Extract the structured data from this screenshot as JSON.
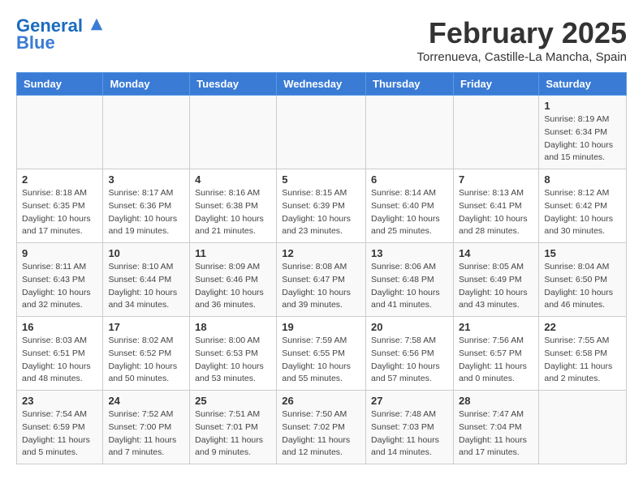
{
  "app": {
    "name": "GeneralBlue",
    "name_part1": "General",
    "name_part2": "Blue"
  },
  "calendar": {
    "month_year": "February 2025",
    "location": "Torrenueva, Castille-La Mancha, Spain",
    "days_of_week": [
      "Sunday",
      "Monday",
      "Tuesday",
      "Wednesday",
      "Thursday",
      "Friday",
      "Saturday"
    ],
    "weeks": [
      {
        "days": [
          {
            "number": "",
            "info": ""
          },
          {
            "number": "",
            "info": ""
          },
          {
            "number": "",
            "info": ""
          },
          {
            "number": "",
            "info": ""
          },
          {
            "number": "",
            "info": ""
          },
          {
            "number": "",
            "info": ""
          },
          {
            "number": "1",
            "info": "Sunrise: 8:19 AM\nSunset: 6:34 PM\nDaylight: 10 hours and 15 minutes."
          }
        ]
      },
      {
        "days": [
          {
            "number": "2",
            "info": "Sunrise: 8:18 AM\nSunset: 6:35 PM\nDaylight: 10 hours and 17 minutes."
          },
          {
            "number": "3",
            "info": "Sunrise: 8:17 AM\nSunset: 6:36 PM\nDaylight: 10 hours and 19 minutes."
          },
          {
            "number": "4",
            "info": "Sunrise: 8:16 AM\nSunset: 6:38 PM\nDaylight: 10 hours and 21 minutes."
          },
          {
            "number": "5",
            "info": "Sunrise: 8:15 AM\nSunset: 6:39 PM\nDaylight: 10 hours and 23 minutes."
          },
          {
            "number": "6",
            "info": "Sunrise: 8:14 AM\nSunset: 6:40 PM\nDaylight: 10 hours and 25 minutes."
          },
          {
            "number": "7",
            "info": "Sunrise: 8:13 AM\nSunset: 6:41 PM\nDaylight: 10 hours and 28 minutes."
          },
          {
            "number": "8",
            "info": "Sunrise: 8:12 AM\nSunset: 6:42 PM\nDaylight: 10 hours and 30 minutes."
          }
        ]
      },
      {
        "days": [
          {
            "number": "9",
            "info": "Sunrise: 8:11 AM\nSunset: 6:43 PM\nDaylight: 10 hours and 32 minutes."
          },
          {
            "number": "10",
            "info": "Sunrise: 8:10 AM\nSunset: 6:44 PM\nDaylight: 10 hours and 34 minutes."
          },
          {
            "number": "11",
            "info": "Sunrise: 8:09 AM\nSunset: 6:46 PM\nDaylight: 10 hours and 36 minutes."
          },
          {
            "number": "12",
            "info": "Sunrise: 8:08 AM\nSunset: 6:47 PM\nDaylight: 10 hours and 39 minutes."
          },
          {
            "number": "13",
            "info": "Sunrise: 8:06 AM\nSunset: 6:48 PM\nDaylight: 10 hours and 41 minutes."
          },
          {
            "number": "14",
            "info": "Sunrise: 8:05 AM\nSunset: 6:49 PM\nDaylight: 10 hours and 43 minutes."
          },
          {
            "number": "15",
            "info": "Sunrise: 8:04 AM\nSunset: 6:50 PM\nDaylight: 10 hours and 46 minutes."
          }
        ]
      },
      {
        "days": [
          {
            "number": "16",
            "info": "Sunrise: 8:03 AM\nSunset: 6:51 PM\nDaylight: 10 hours and 48 minutes."
          },
          {
            "number": "17",
            "info": "Sunrise: 8:02 AM\nSunset: 6:52 PM\nDaylight: 10 hours and 50 minutes."
          },
          {
            "number": "18",
            "info": "Sunrise: 8:00 AM\nSunset: 6:53 PM\nDaylight: 10 hours and 53 minutes."
          },
          {
            "number": "19",
            "info": "Sunrise: 7:59 AM\nSunset: 6:55 PM\nDaylight: 10 hours and 55 minutes."
          },
          {
            "number": "20",
            "info": "Sunrise: 7:58 AM\nSunset: 6:56 PM\nDaylight: 10 hours and 57 minutes."
          },
          {
            "number": "21",
            "info": "Sunrise: 7:56 AM\nSunset: 6:57 PM\nDaylight: 11 hours and 0 minutes."
          },
          {
            "number": "22",
            "info": "Sunrise: 7:55 AM\nSunset: 6:58 PM\nDaylight: 11 hours and 2 minutes."
          }
        ]
      },
      {
        "days": [
          {
            "number": "23",
            "info": "Sunrise: 7:54 AM\nSunset: 6:59 PM\nDaylight: 11 hours and 5 minutes."
          },
          {
            "number": "24",
            "info": "Sunrise: 7:52 AM\nSunset: 7:00 PM\nDaylight: 11 hours and 7 minutes."
          },
          {
            "number": "25",
            "info": "Sunrise: 7:51 AM\nSunset: 7:01 PM\nDaylight: 11 hours and 9 minutes."
          },
          {
            "number": "26",
            "info": "Sunrise: 7:50 AM\nSunset: 7:02 PM\nDaylight: 11 hours and 12 minutes."
          },
          {
            "number": "27",
            "info": "Sunrise: 7:48 AM\nSunset: 7:03 PM\nDaylight: 11 hours and 14 minutes."
          },
          {
            "number": "28",
            "info": "Sunrise: 7:47 AM\nSunset: 7:04 PM\nDaylight: 11 hours and 17 minutes."
          },
          {
            "number": "",
            "info": ""
          }
        ]
      }
    ]
  }
}
